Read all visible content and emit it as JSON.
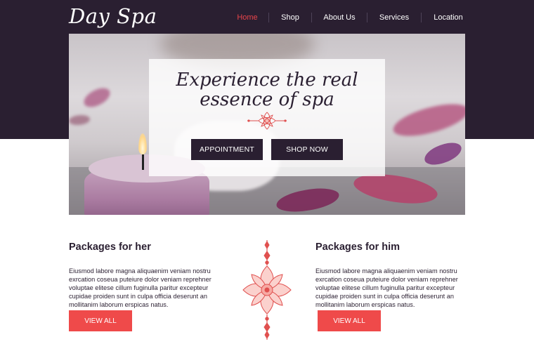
{
  "header": {
    "logo": "Day Spa",
    "nav": [
      {
        "label": "Home",
        "active": true
      },
      {
        "label": "Shop",
        "active": false
      },
      {
        "label": "About Us",
        "active": false
      },
      {
        "label": "Services",
        "active": false
      },
      {
        "label": "Location",
        "active": false
      }
    ]
  },
  "hero": {
    "title_line1": "Experience the real",
    "title_line2": "essence of spa",
    "appointment_label": "APPOINTMENT",
    "shop_label": "SHOP NOW"
  },
  "packages": {
    "her": {
      "title": "Packages for her",
      "text": "Eiusmod labore magna aliquaenim veniam nostru exrcation coseua puteiure dolor veniam reprehner voluptae elitese cillum fuginulla paritur excepteur cupidae proiden sunt in culpa officia deserunt an mollitanim laborum erspicas natus.",
      "button": "VIEW ALL"
    },
    "him": {
      "title": "Packages for him",
      "text": "Eiusmod labore magna aliquaenim veniam nostru exrcation coseua puteiure dolor veniam reprehner voluptae elitese cillum fuginulla paritur excepteur cupidae proiden sunt in culpa officia deserunt an mollitanim laborum erspicas natus.",
      "button": "VIEW ALL"
    }
  },
  "colors": {
    "dark": "#2a1f31",
    "accent": "#ef4a4a",
    "active_nav": "#e8444a"
  },
  "icons": {
    "hero_ornament": "lotus-ornament-icon",
    "divider_ornament": "lotus-divider-icon"
  }
}
